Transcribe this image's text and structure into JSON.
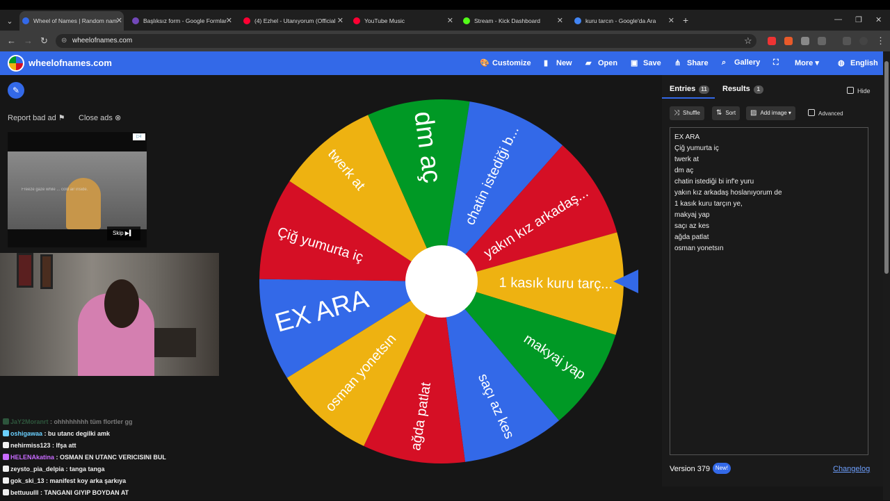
{
  "browser": {
    "tabs": [
      {
        "title": "Wheel of Names | Random nam",
        "active": true,
        "favicon_color": "#3369e8"
      },
      {
        "title": "Başlıksız form - Google Formlar",
        "active": false,
        "favicon_color": "#7248b9"
      },
      {
        "title": "(4) Ezhel - Utanıyorum (Official",
        "active": false,
        "favicon_color": "#ff0033"
      },
      {
        "title": "YouTube Music",
        "active": false,
        "favicon_color": "#ff0033"
      },
      {
        "title": "Stream - Kick Dashboard",
        "active": false,
        "favicon_color": "#53fc18"
      },
      {
        "title": "kuru tarcın - Google'da Ara",
        "active": false,
        "favicon_color": "#4285f4"
      }
    ],
    "url": "wheelofnames.com"
  },
  "site": {
    "brand": "wheelofnames.com",
    "menu": [
      {
        "label": "Customize",
        "icon": "palette-icon",
        "glyph": "🎨"
      },
      {
        "label": "New",
        "icon": "file-icon",
        "glyph": "▮"
      },
      {
        "label": "Open",
        "icon": "folder-icon",
        "glyph": "▰"
      },
      {
        "label": "Save",
        "icon": "save-icon",
        "glyph": "▣"
      },
      {
        "label": "Share",
        "icon": "share-icon",
        "glyph": "⋔"
      },
      {
        "label": "Gallery",
        "icon": "search-icon",
        "glyph": "⌕"
      },
      {
        "label": "",
        "icon": "fullscreen-icon",
        "glyph": "⛶"
      },
      {
        "label": "More ▾",
        "icon": "",
        "glyph": ""
      },
      {
        "label": "English",
        "icon": "globe-icon",
        "glyph": "◍"
      }
    ]
  },
  "ads": {
    "report_label": "Report bad ad",
    "close_label": "Close ads",
    "video_caption": "Freeze gaze while ... cold air inside.",
    "skip_label": "Skip"
  },
  "wheel": {
    "segments": [
      {
        "label": "EX ARA",
        "color": "#3369e8"
      },
      {
        "label": "Çiğ yumurta iç",
        "color": "#d50f25"
      },
      {
        "label": "twerk at",
        "color": "#eeb211"
      },
      {
        "label": "dm aç",
        "color": "#009925"
      },
      {
        "label": "chatin istediği b...",
        "color": "#3369e8"
      },
      {
        "label": "yakın kız arkadaş...",
        "color": "#d50f25"
      },
      {
        "label": "1 kasık kuru tarç...",
        "color": "#eeb211"
      },
      {
        "label": "makyaj yap",
        "color": "#009925"
      },
      {
        "label": "saçı az kes",
        "color": "#3369e8"
      },
      {
        "label": "ağda patlat",
        "color": "#d50f25"
      },
      {
        "label": "osman yonetsın",
        "color": "#eeb211"
      }
    ]
  },
  "sidebar": {
    "tabs": [
      {
        "label": "Entries",
        "count": "11"
      },
      {
        "label": "Results",
        "count": "1"
      }
    ],
    "hide_label": "Hide",
    "tools": [
      {
        "label": "Shuffle",
        "glyph": "⤨"
      },
      {
        "label": "Sort",
        "glyph": "⇅"
      },
      {
        "label": "Add image ▾",
        "glyph": "▨"
      }
    ],
    "advanced_label": "Advanced",
    "entries": [
      "EX ARA",
      "Çiğ yumurta iç",
      "twerk at",
      "dm aç",
      "chatin istediği bi inf'e yuru",
      "yakın kız arkadaş hoslanıyorum de",
      "1 kasık kuru tarçın ye,",
      "makyaj yap",
      "saçı az kes",
      "ağda patlat",
      "osman yonetsın"
    ],
    "version": "Version 379",
    "new_badge": "New!",
    "changelog": "Changelog"
  },
  "chat": [
    {
      "user": "JaY2Moranrt",
      "text": "ohhhhhhhh tüm flortler gg",
      "color": "#4aa36a",
      "faded": true
    },
    {
      "user": "oshigawaa",
      "text": "bu utanc degilki amk",
      "color": "#6ad0ff",
      "faded": false
    },
    {
      "user": "nehirmiss123",
      "text": "Ifşa att",
      "color": "#f0f0f0",
      "faded": false
    },
    {
      "user": "HELENAkatina",
      "text": "OSMAN EN UTANC VERICISINI BUL",
      "color": "#c86bff",
      "faded": false
    },
    {
      "user": "zeysto_pia_delpia",
      "text": "tanga tanga",
      "color": "#f0f0f0",
      "faded": false
    },
    {
      "user": "gok_ski_13",
      "text": "manifest koy arka şarkıya",
      "color": "#f0f0f0",
      "faded": false
    },
    {
      "user": "bettuuulll",
      "text": "TANGANI GIYIP BOYDAN AT",
      "color": "#f0f0f0",
      "faded": false
    }
  ]
}
